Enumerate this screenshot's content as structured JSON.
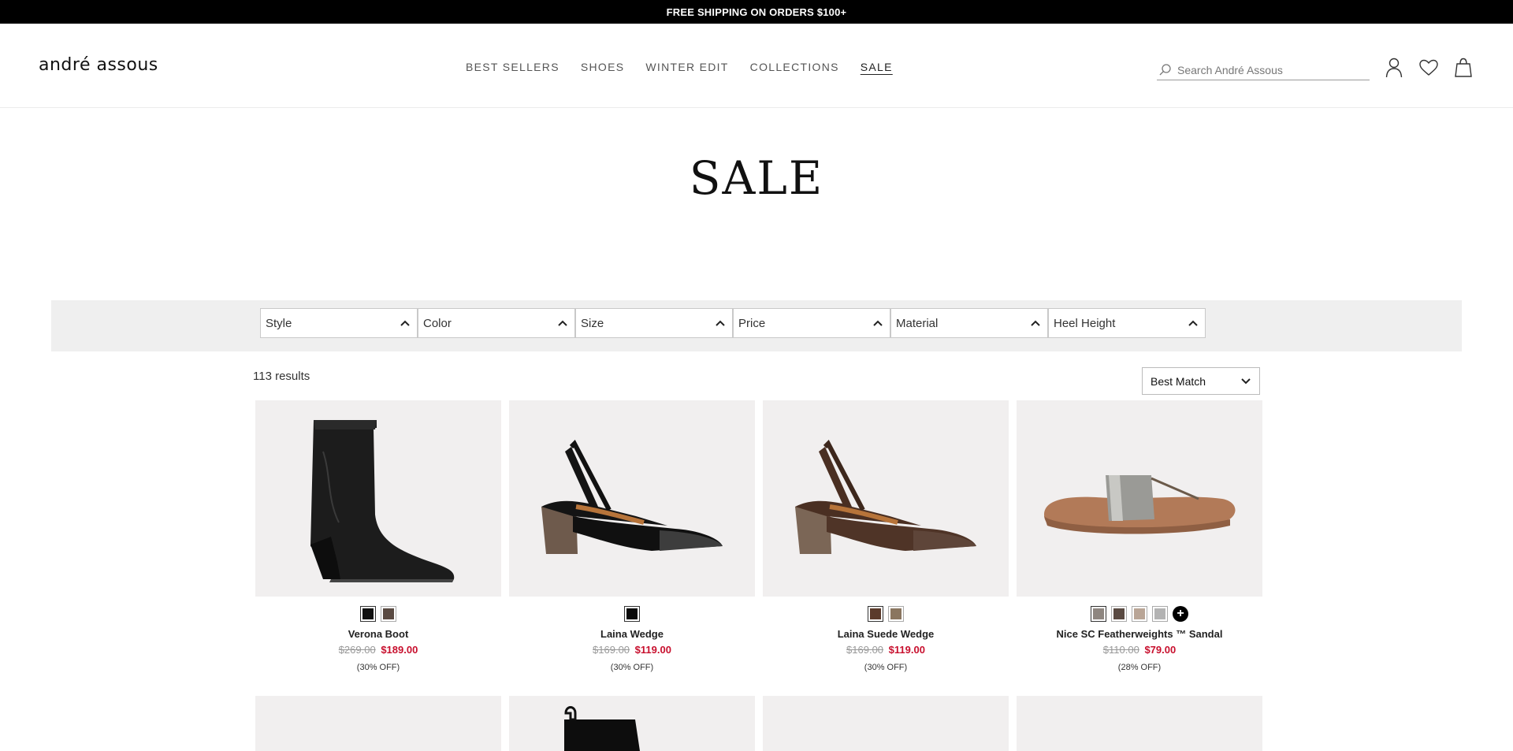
{
  "announcement": "FREE SHIPPING ON ORDERS $100+",
  "brand": {
    "logo_text": "andré assous"
  },
  "nav": [
    {
      "label": "BEST SELLERS"
    },
    {
      "label": "SHOES"
    },
    {
      "label": "WINTER EDIT"
    },
    {
      "label": "COLLECTIONS"
    },
    {
      "label": "SALE"
    }
  ],
  "search": {
    "placeholder": "Search André Assous",
    "icon": "search-icon"
  },
  "header_icons": [
    "account-icon",
    "wishlist-heart-icon",
    "shopping-bag-icon"
  ],
  "page": {
    "title": "SALE"
  },
  "filters": [
    {
      "label": "Style"
    },
    {
      "label": "Color"
    },
    {
      "label": "Size"
    },
    {
      "label": "Price"
    },
    {
      "label": "Material"
    },
    {
      "label": "Heel Height"
    }
  ],
  "results": {
    "count_text": "113 results"
  },
  "sort": {
    "selected": "Best Match"
  },
  "products": [
    {
      "name": "Verona Boot",
      "old_price": "$269.00",
      "sale_price": "$189.00",
      "discount": "(30% OFF)",
      "swatches": [
        "#111111",
        "#5a4a42"
      ]
    },
    {
      "name": "Laina Wedge",
      "old_price": "$169.00",
      "sale_price": "$119.00",
      "discount": "(30% OFF)",
      "swatches": [
        "#0a0a0a"
      ]
    },
    {
      "name": "Laina Suede Wedge",
      "old_price": "$169.00",
      "sale_price": "$119.00",
      "discount": "(30% OFF)",
      "swatches": [
        "#5b3b2c",
        "#8a7660"
      ]
    },
    {
      "name": "Nice SC Featherweights ™ Sandal",
      "old_price": "$110.00",
      "sale_price": "$79.00",
      "discount": "(28% OFF)",
      "swatches": [
        "#8e8680",
        "#5a4a42",
        "#b9a596",
        "#b3b3b3"
      ]
    }
  ],
  "colors": {
    "sale_red": "#c8102e",
    "announcement_bg": "#000000",
    "filter_bar_bg": "#efefef",
    "product_bg": "#f1efef"
  }
}
